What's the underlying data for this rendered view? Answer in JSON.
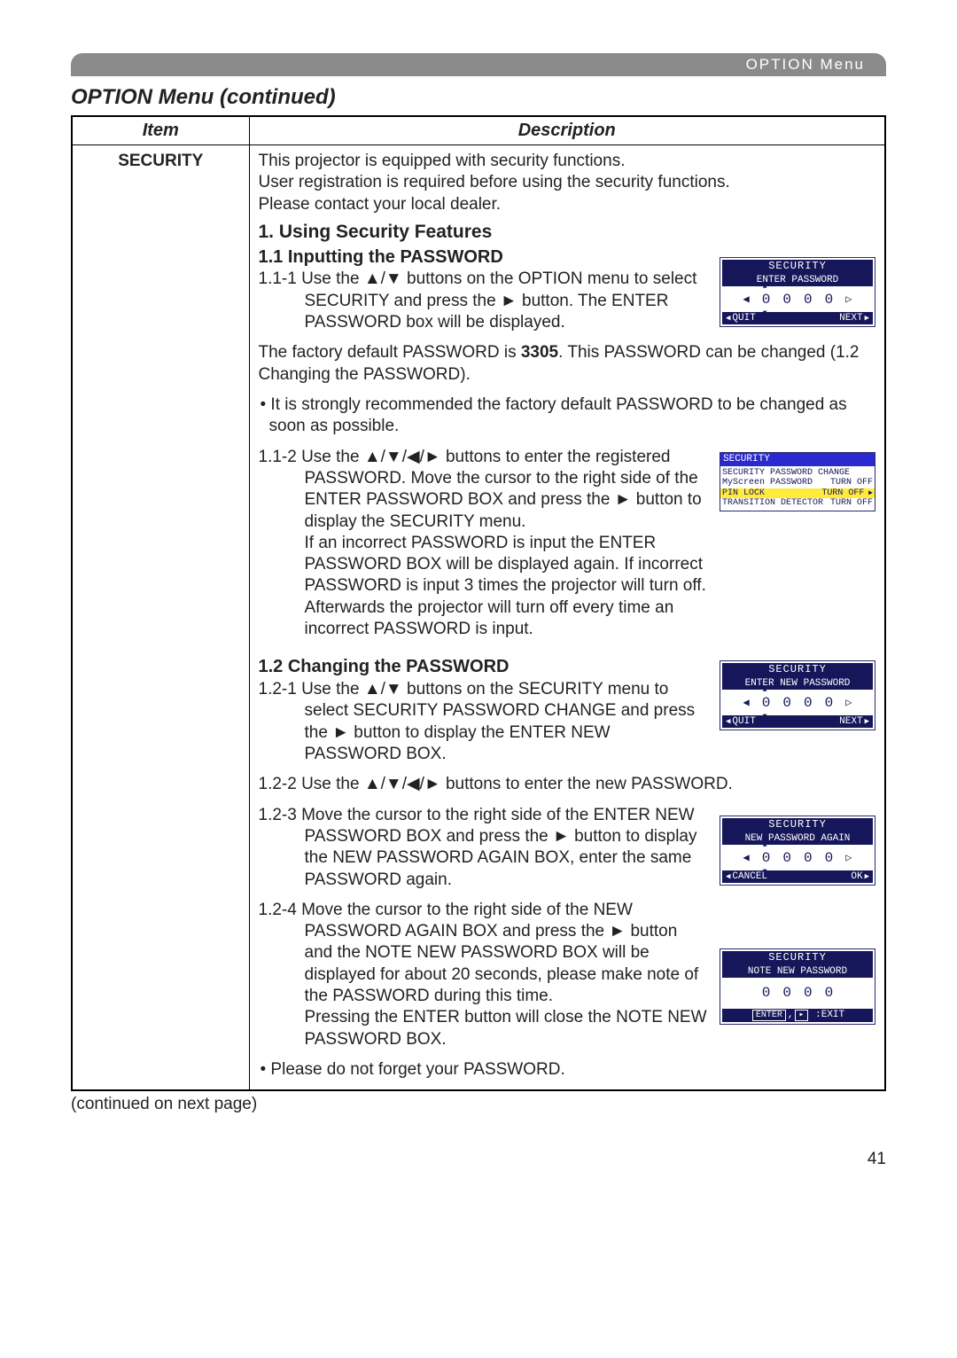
{
  "header": {
    "breadcrumb": "OPTION Menu"
  },
  "title": "OPTION Menu (continued)",
  "table": {
    "col_item": "Item",
    "col_desc": "Description",
    "item_label": "SECURITY"
  },
  "intro": {
    "l1": "This projector is equipped with security functions.",
    "l2": "User registration is required before using the security functions.",
    "l3": "Please contact your local dealer."
  },
  "sec1": {
    "title": "1. Using Security Features",
    "sub11": "1.1 Inputting the PASSWORD",
    "p111": "1.1-1 Use the ▲/▼ buttons on the OPTION menu to select SECURITY and press the ► button. The ENTER PASSWORD box will be displayed.",
    "p_default1": "The factory default PASSWORD is ",
    "p_default_bold": "3305",
    "p_default2": ". This PASSWORD can be changed (1.2 Changing the PASSWORD).",
    "p_rec": "• It is strongly recommended the factory default PASSWORD to be changed as soon as possible.",
    "p112": "1.1-2 Use the ▲/▼/◀/► buttons to enter the registered PASSWORD. Move the cursor to the right side of the ENTER PASSWORD BOX and press the ► button to display the SECURITY menu.\nIf an incorrect PASSWORD is input the ENTER PASSWORD BOX will be displayed again. If incorrect PASSWORD is input 3 times the projector will turn off. Afterwards the projector will turn off every time an incorrect PASSWORD is input.",
    "sub12": "1.2 Changing the PASSWORD",
    "p121": "1.2-1 Use the ▲/▼ buttons on the SECURITY menu to select SECURITY PASSWORD CHANGE and press the ► button to display the ENTER NEW PASSWORD BOX.",
    "p122": "1.2-2 Use the ▲/▼/◀/► buttons to enter the new PASSWORD.",
    "p123": "1.2-3 Move the cursor to the right side of the ENTER NEW PASSWORD BOX and press the ► button to display the NEW PASSWORD AGAIN BOX, enter the same PASSWORD again.",
    "p124": "1.2-4 Move the cursor to the right side of the NEW PASSWORD AGAIN BOX and press the ► button and the NOTE NEW PASSWORD BOX will be displayed for about 20 seconds, please make note of the PASSWORD during this time.\nPressing the ENTER button will close the NOTE NEW PASSWORD BOX.",
    "p_noforget": "• Please do not forget your PASSWORD."
  },
  "osd1": {
    "hdr": "SECURITY",
    "sub": "ENTER PASSWORD",
    "digits": [
      "0",
      "0",
      "0",
      "0"
    ],
    "left": "QUIT",
    "right": "NEXT"
  },
  "osd2": {
    "hdr": "SECURITY",
    "rows": [
      {
        "l": "SECURITY PASSWORD CHANGE",
        "r": ""
      },
      {
        "l": "MyScreen PASSWORD",
        "r": "TURN OFF"
      },
      {
        "l": "PIN LOCK",
        "r": "TURN OFF",
        "hl": true
      },
      {
        "l": "TRANSITION DETECTOR",
        "r": "TURN OFF"
      }
    ]
  },
  "osd3": {
    "hdr": "SECURITY",
    "sub": "ENTER NEW PASSWORD",
    "digits": [
      "0",
      "0",
      "0",
      "0"
    ],
    "left": "QUIT",
    "right": "NEXT"
  },
  "osd4": {
    "hdr": "SECURITY",
    "sub": "NEW PASSWORD AGAIN",
    "digits": [
      "0",
      "0",
      "0",
      "0"
    ],
    "left": "CANCEL",
    "right": "OK"
  },
  "osd5": {
    "hdr": "SECURITY",
    "sub": "NOTE NEW PASSWORD",
    "digits": [
      "0",
      "0",
      "0",
      "0"
    ],
    "footer_enter": "ENTER",
    "footer_exit": ":EXIT"
  },
  "footer": "(continued on next page)",
  "page": "41"
}
